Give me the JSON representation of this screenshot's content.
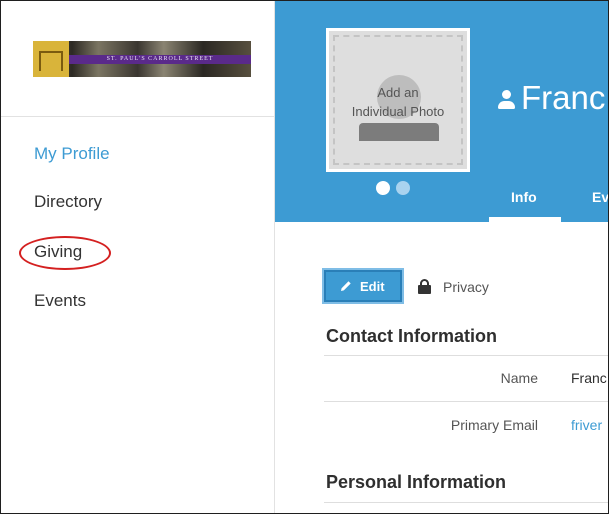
{
  "sidebar": {
    "logo_text": "ST. PAUL'S CARROLL STREET",
    "items": [
      {
        "label": "My Profile",
        "active": true
      },
      {
        "label": "Directory",
        "active": false
      },
      {
        "label": "Giving",
        "active": false,
        "highlighted": true
      },
      {
        "label": "Events",
        "active": false
      }
    ]
  },
  "banner": {
    "photo_placeholder": [
      "Add an",
      "Individual Photo"
    ],
    "profile_name": "Franc",
    "tabs": [
      {
        "label": "Info",
        "active": true
      },
      {
        "label": "Ev",
        "active": false
      }
    ]
  },
  "toolbar": {
    "edit_label": "Edit",
    "privacy_label": "Privacy"
  },
  "sections": {
    "contact_title": "Contact Information",
    "contact_fields": [
      {
        "label": "Name",
        "value": "Franc",
        "link": false
      },
      {
        "label": "Primary Email",
        "value": "friver",
        "link": true
      }
    ],
    "personal_title": "Personal Information"
  },
  "colors": {
    "accent": "#3d9bd3",
    "highlight_circle": "#d42020"
  }
}
